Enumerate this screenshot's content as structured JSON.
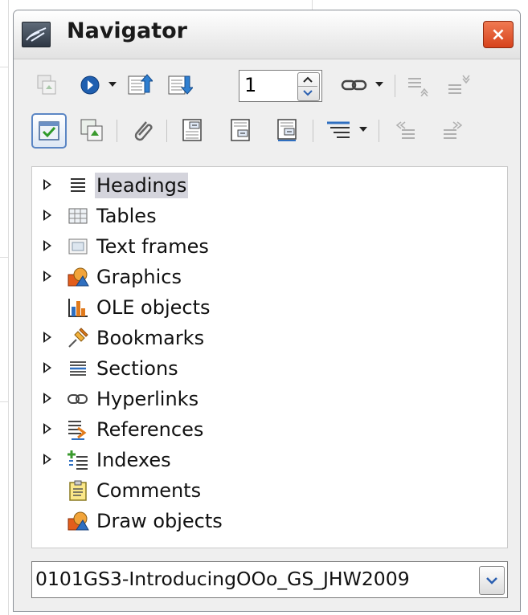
{
  "window": {
    "title": "Navigator",
    "close_label": "×"
  },
  "toolbar": {
    "page_number": "1"
  },
  "tree": {
    "items": [
      {
        "label": "Headings",
        "icon": "headings-icon",
        "expandable": true,
        "selected": true
      },
      {
        "label": "Tables",
        "icon": "table-icon",
        "expandable": true
      },
      {
        "label": "Text frames",
        "icon": "text-frame-icon",
        "expandable": true
      },
      {
        "label": "Graphics",
        "icon": "graphics-icon",
        "expandable": true
      },
      {
        "label": "OLE objects",
        "icon": "ole-chart-icon",
        "expandable": false
      },
      {
        "label": "Bookmarks",
        "icon": "pushpin-icon",
        "expandable": true
      },
      {
        "label": "Sections",
        "icon": "sections-icon",
        "expandable": true
      },
      {
        "label": "Hyperlinks",
        "icon": "chain-link-icon",
        "expandable": true
      },
      {
        "label": "References",
        "icon": "references-icon",
        "expandable": true
      },
      {
        "label": "Indexes",
        "icon": "indexes-icon",
        "expandable": true
      },
      {
        "label": "Comments",
        "icon": "comment-note-icon",
        "expandable": false
      },
      {
        "label": "Draw objects",
        "icon": "draw-objects-icon",
        "expandable": false
      }
    ]
  },
  "document_selector": {
    "value": "0101GS3-IntroducingOOo_GS_JHW2009"
  },
  "colors": {
    "close_button": "#d6421c",
    "selection": "#d4d4dc",
    "active_toggle_border": "#5b86c4",
    "icon_blue": "#2f6fc0",
    "icon_green": "#3a9a2e",
    "icon_orange": "#e07a1c"
  }
}
